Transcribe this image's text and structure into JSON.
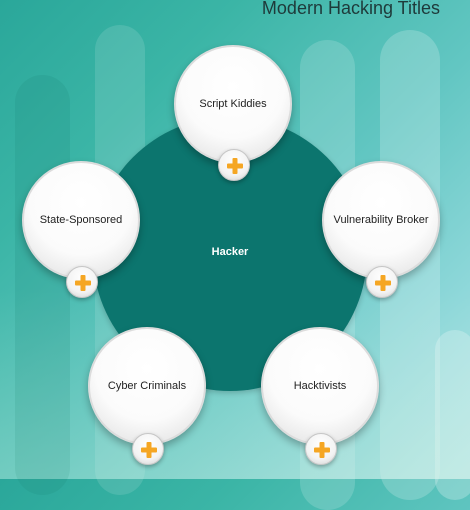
{
  "title": "Modern Hacking Titles",
  "center": {
    "label": "Hacker",
    "color": "#0c756e"
  },
  "accent": "#f5a623",
  "nodes": [
    {
      "key": "script-kiddies",
      "label": "Script Kiddies",
      "icon": "plus-icon"
    },
    {
      "key": "state-sponsored",
      "label": "State-Sponsored",
      "icon": "plus-icon"
    },
    {
      "key": "vulnerability-broker",
      "label": "Vulnerability Broker",
      "icon": "plus-icon"
    },
    {
      "key": "cyber-criminals",
      "label": "Cyber Criminals",
      "icon": "plus-icon"
    },
    {
      "key": "hacktivists",
      "label": "Hacktivists",
      "icon": "plus-icon"
    }
  ]
}
